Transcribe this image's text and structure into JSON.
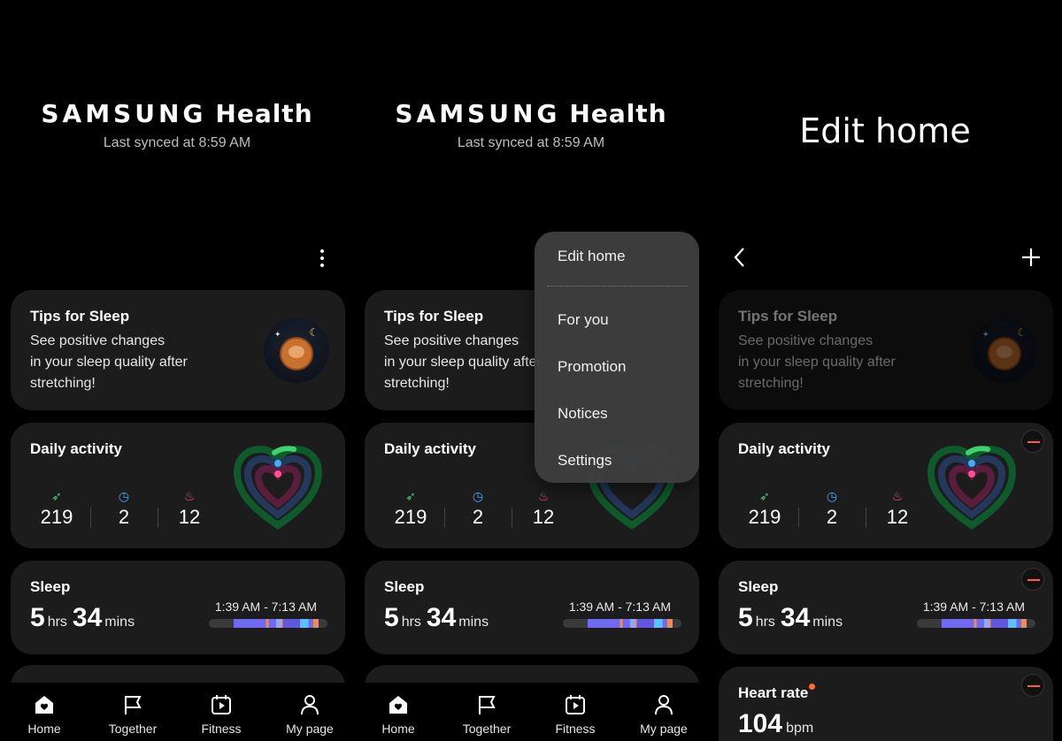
{
  "brand": {
    "samsung": "SAMSUNG",
    "health": "Health",
    "synced": "Last synced at 8:59 AM"
  },
  "edit_title": "Edit home",
  "tips": {
    "title": "Tips for Sleep",
    "line1": "See positive changes",
    "line2": "in your sleep quality after",
    "line3": "stretching!"
  },
  "daily": {
    "title": "Daily activity",
    "steps": "219",
    "minutes": "2",
    "calories": "12",
    "icons": [
      "shoe-icon",
      "clock-icon",
      "flame-icon"
    ]
  },
  "sleep": {
    "title": "Sleep",
    "hours": "5",
    "hours_unit": "hrs",
    "mins": "34",
    "mins_unit": "mins",
    "range": "1:39 AM - 7:13 AM"
  },
  "heart_rate": {
    "title": "Heart rate",
    "value": "104",
    "unit": "bpm"
  },
  "menu": {
    "edit_home": "Edit home",
    "for_you": "For you",
    "promotion": "Promotion",
    "notices": "Notices",
    "settings": "Settings"
  },
  "nav": [
    {
      "label": "Home",
      "icon": "home-icon"
    },
    {
      "label": "Together",
      "icon": "flag-icon"
    },
    {
      "label": "Fitness",
      "icon": "fitness-icon"
    },
    {
      "label": "My page",
      "icon": "person-icon"
    }
  ],
  "colors": {
    "background": "#000000",
    "card": "#1c1c1c",
    "steps": "#3ed26f",
    "active": "#4aa7ff",
    "calories": "#ff4f8f",
    "remove": "#ff5a4e"
  }
}
